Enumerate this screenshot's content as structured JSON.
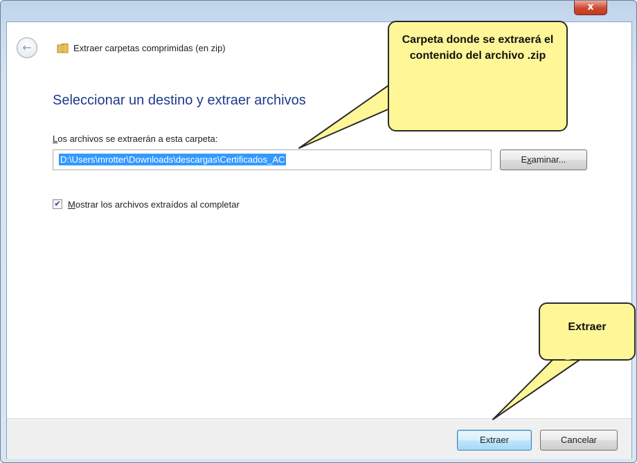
{
  "window": {
    "title": "Extraer carpetas comprimidas (en zip)",
    "close_glyph": "x"
  },
  "page": {
    "heading": "Seleccionar un destino y extraer archivos",
    "dest_label_ak": "L",
    "dest_label_rest": "os archivos se extraerán a esta carpeta:",
    "path_value": "D:\\Users\\mrotter\\Downloads\\descargas\\Certificados_AC",
    "browse_ak": "x",
    "browse_pre": "E",
    "browse_rest": "aminar...",
    "show_checkbox_checked": true,
    "show_label_ak": "M",
    "show_label_rest": "ostrar los archivos extraídos al completar"
  },
  "footer": {
    "extract_label": "Extraer",
    "cancel_label": "Cancelar"
  },
  "callouts": {
    "destination_note": "Carpeta donde se extraerá el contenido del archivo .zip",
    "extract_note": "Extraer"
  },
  "icons": [
    "back-arrow-icon",
    "zip-folder-icon",
    "close-icon",
    "checkmark-icon"
  ],
  "colors": {
    "callout_fill": "#fff797",
    "heading_blue": "#1e3a8a",
    "selection": "#3399ff"
  }
}
